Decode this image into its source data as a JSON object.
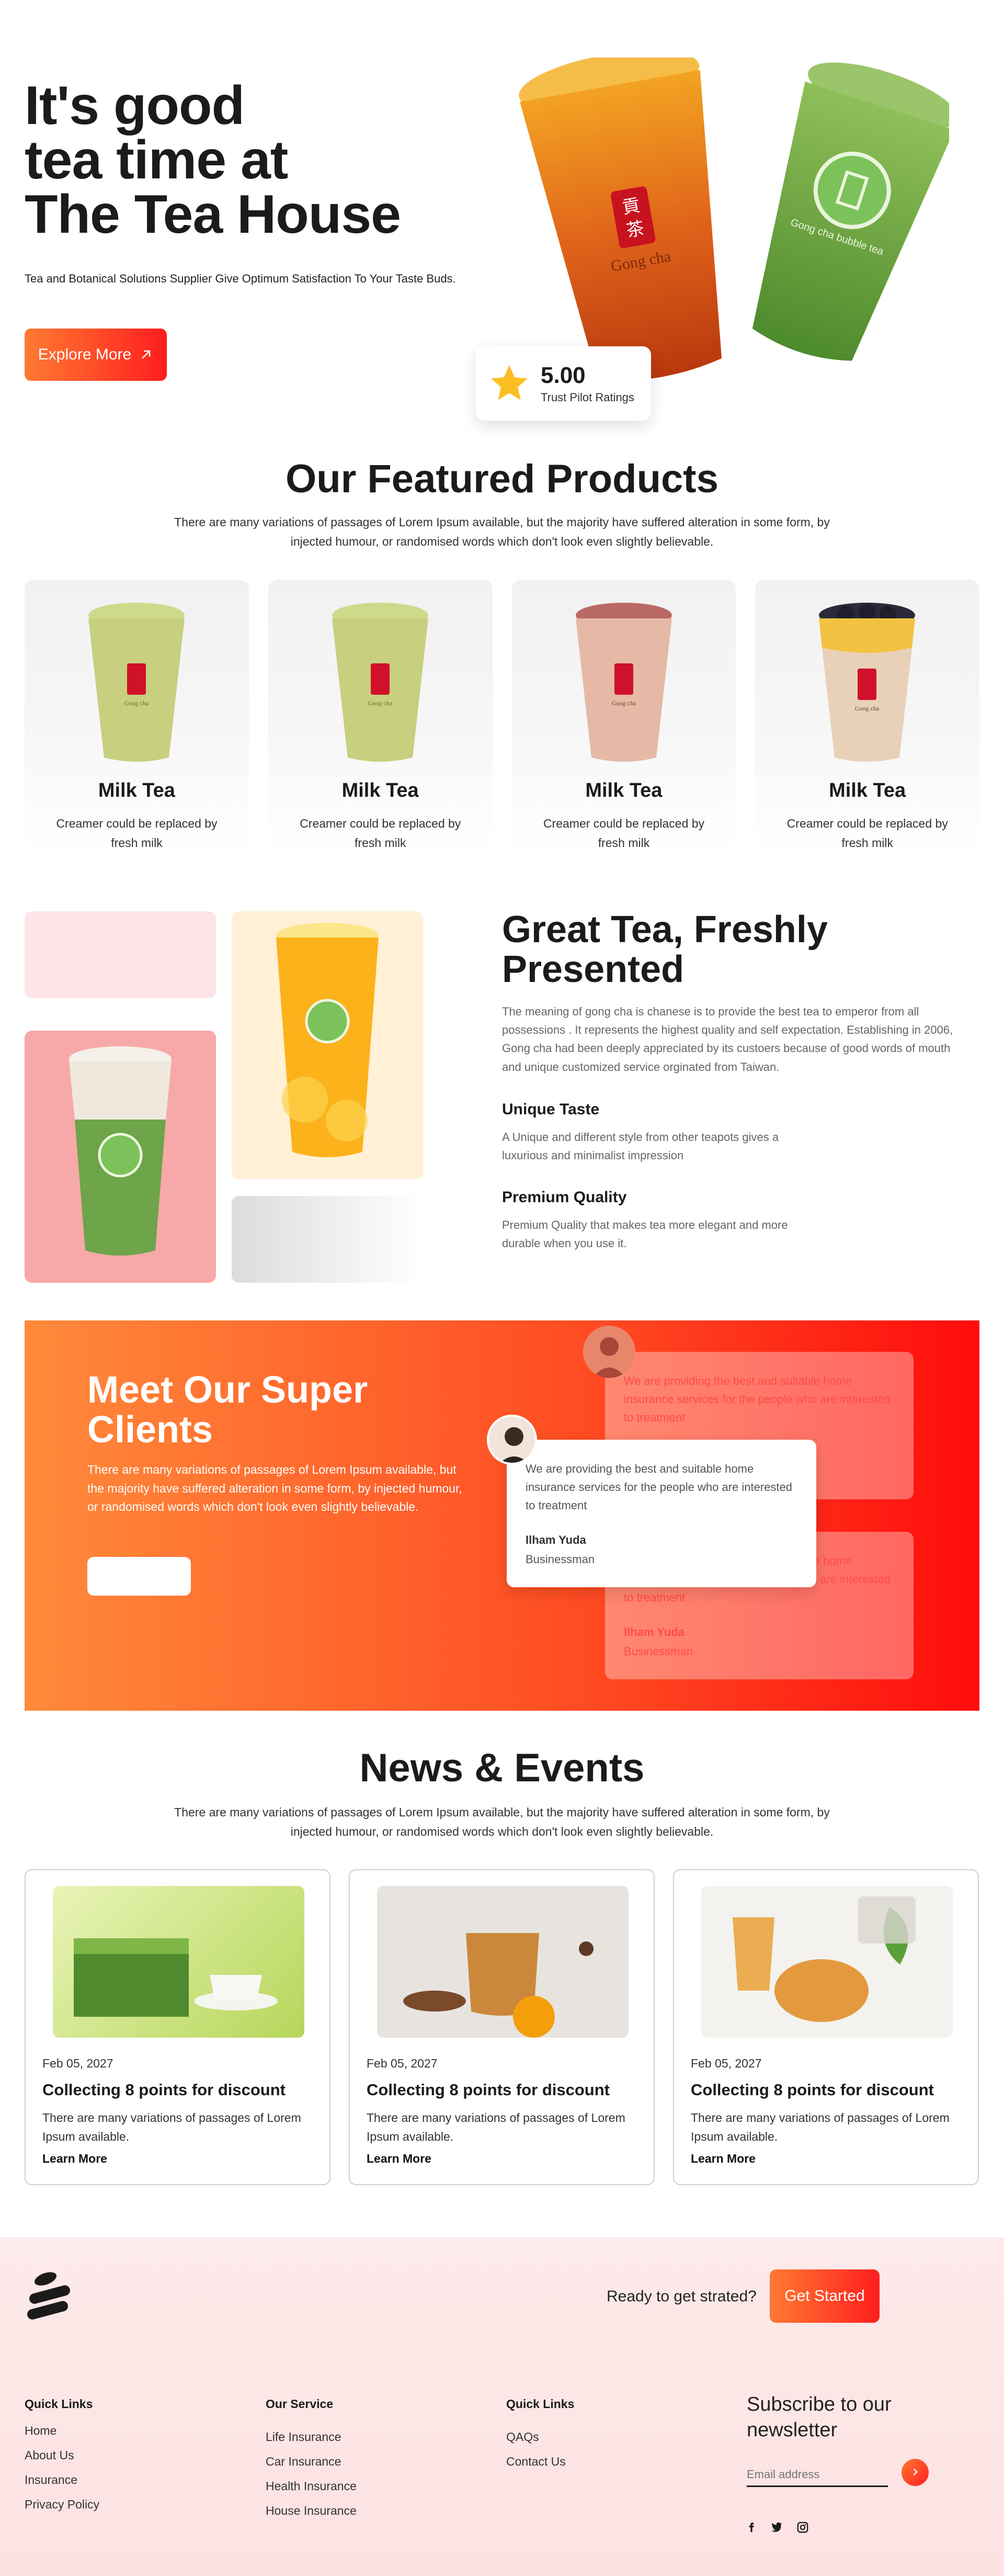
{
  "hero": {
    "title_line1": "It's good",
    "title_line2": "tea time at",
    "title_line3": "The Tea House",
    "subtitle": "Tea and Botanical Solutions Supplier Give Optimum Satisfaction To Your Taste Buds.",
    "cta_label": "Explore More",
    "cup_brand_left": "Gong cha",
    "cup_brand_right": "Gong cha bubble tea",
    "rating_value": "5.00",
    "rating_label": "Trust Pilot Ratings"
  },
  "featured": {
    "title": "Our Featured Products",
    "description": "There are many variations of passages of Lorem Ipsum available, but the majority have suffered alteration in some form, by injected humour, or randomised words which don't look even slightly believable.",
    "products": [
      {
        "name": "Milk Tea",
        "description": "Creamer could be replaced by fresh milk"
      },
      {
        "name": "Milk Tea",
        "description": "Creamer could be replaced by fresh milk"
      },
      {
        "name": "Milk Tea",
        "description": "Creamer could be replaced by fresh milk"
      },
      {
        "name": "Milk Tea",
        "description": "Creamer could be replaced by fresh milk"
      }
    ]
  },
  "great_tea": {
    "title": "Great Tea, Freshly Presented",
    "description": "The meaning of gong cha is chanese is to provide the best tea to emperor from all possessions . It represents the highest quality and self expectation. Establishing in 2006, Gong cha had been deeply appreciated by its custoers because of good words of mouth and unique customized service orginated from Taiwan.",
    "features": [
      {
        "title": "Unique Taste",
        "description": "A Unique and different style from other teapots gives a luxurious and minimalist impression"
      },
      {
        "title": "Premium Quality",
        "description": "Premium Quality that makes tea more elegant and more durable when you use it."
      }
    ]
  },
  "clients": {
    "title": "Meet Our Super Clients",
    "description": "There are many variations of passages of Lorem Ipsum available, but the majority have suffered alteration in some form, by injected humour, or randomised words which don't look even slightly believable.",
    "button_label": "",
    "testimonials": [
      {
        "quote": "We are providing the best and suitable home insurance services for the people who are interested to treatment",
        "name": "Ilham Yuda",
        "role": "Businessman"
      },
      {
        "quote": "We are providing the best and suitable home insurance services for the people who are interested to treatment",
        "name": "Ilham Yuda",
        "role": "Businessman"
      },
      {
        "quote": "We are providing the best and suitable home insurance services for the people who are interested to treatment",
        "name": "Ilham Yuda",
        "role": "Businessman"
      }
    ]
  },
  "news": {
    "title": "News & Events",
    "description": "There are many variations of passages of Lorem Ipsum available, but the majority have suffered alteration in some form, by injected humour, or randomised words which don't look even slightly believable.",
    "items": [
      {
        "date": "Feb 05, 2027",
        "title": "Collecting 8 points for discount",
        "description": "There are many variations of passages of Lorem Ipsum available.",
        "link": "Learn More"
      },
      {
        "date": "Feb 05, 2027",
        "title": "Collecting 8 points for discount",
        "description": "There are many variations of passages of Lorem Ipsum available.",
        "link": "Learn More"
      },
      {
        "date": "Feb 05, 2027",
        "title": "Collecting 8 points for discount",
        "description": "There are many variations of passages of Lorem Ipsum available.",
        "link": "Learn More"
      }
    ]
  },
  "footer": {
    "ready_text": "Ready to get strated?",
    "cta_label": "Get Started",
    "columns": [
      {
        "title": "Quick Links",
        "links": [
          "Home",
          "About Us",
          "Insurance",
          "Privacy Policy"
        ]
      },
      {
        "title": "Our Service",
        "links": [
          "Life Insurance",
          "Car Insurance",
          "Health Insurance",
          "House Insurance"
        ]
      },
      {
        "title": "Quick Links",
        "links": [
          "QAQs",
          "Contact Us"
        ]
      }
    ],
    "newsletter_title": "Subscribe to our newsletter",
    "email_placeholder": "Email address",
    "social": [
      "facebook-icon",
      "twitter-icon",
      "instagram-icon"
    ]
  },
  "colors": {
    "accent_start": "#ff7a32",
    "accent_end": "#ff1e1e",
    "star": "#fbbf24"
  }
}
